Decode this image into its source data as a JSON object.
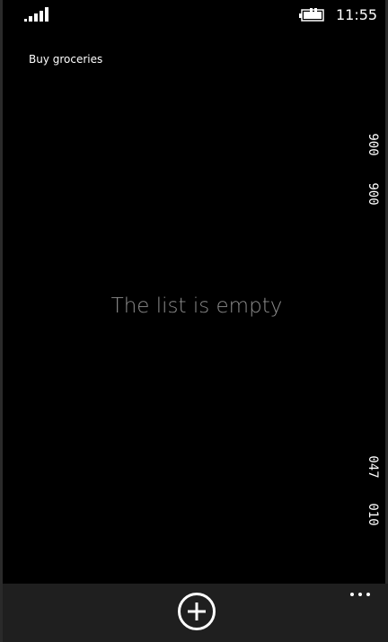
{
  "status_bar": {
    "time": "11:55",
    "signal_icon": "signal-bars-icon",
    "battery_icon": "battery-charging-icon"
  },
  "app": {
    "title": "Buy groceries"
  },
  "list": {
    "empty_message": "The list is empty"
  },
  "debug_counters": [
    "900",
    "900",
    "047",
    "010"
  ],
  "app_bar": {
    "add_icon": "add-circle-icon",
    "more_icon": "ellipsis-icon"
  },
  "colors": {
    "background": "#000000",
    "app_bar": "#1f1f1f",
    "muted_text": "#8c8c8c",
    "foreground": "#ffffff"
  }
}
